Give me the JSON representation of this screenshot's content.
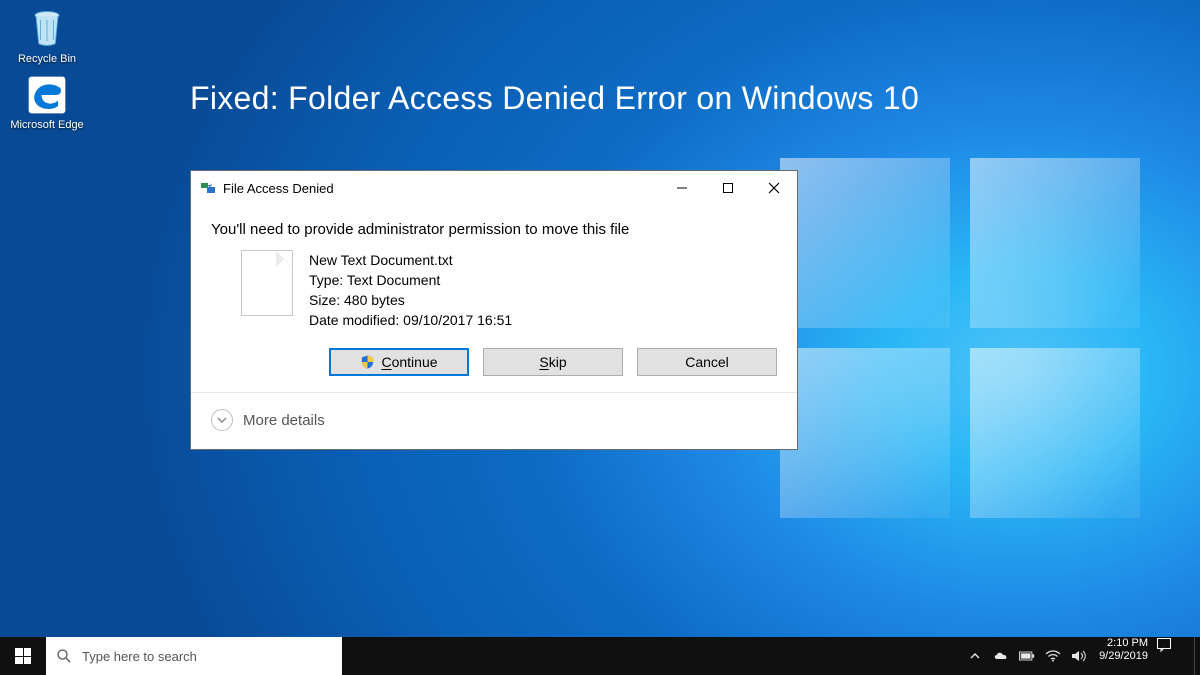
{
  "headline": "Fixed: Folder Access Denied Error on Windows 10",
  "desktop_icons": [
    {
      "name": "Recycle Bin"
    },
    {
      "name": "Microsoft Edge"
    }
  ],
  "dialog": {
    "title": "File Access Denied",
    "message": "You'll need to provide administrator permission to move this file",
    "file": {
      "name": "New Text Document.txt",
      "type_label": "Type: Text Document",
      "size_label": "Size: 480 bytes",
      "modified_label": "Date modified: 09/10/2017 16:51"
    },
    "buttons": {
      "continue_pre": "",
      "continue_u": "C",
      "continue_rest": "ontinue",
      "skip_pre": "",
      "skip_u": "S",
      "skip_rest": "kip",
      "cancel": "Cancel"
    },
    "more_details": "More details"
  },
  "taskbar": {
    "search_placeholder": "Type here to search",
    "clock": {
      "time": "2:10 PM",
      "date": "9/29/2019"
    }
  }
}
